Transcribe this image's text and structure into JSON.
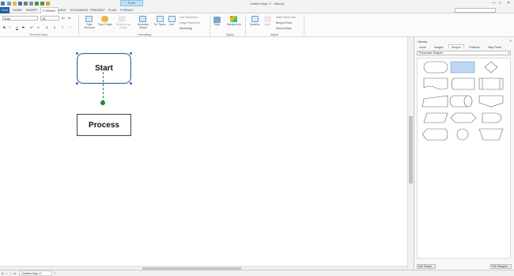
{
  "window": {
    "title": "Untitled Map 1* - iMindQ",
    "context_tab": "Form",
    "minimize": "—",
    "maximize": "□",
    "close": "✕"
  },
  "menu": {
    "file": "FILE",
    "tabs": [
      "HOME",
      "INSERT",
      "FORMAT",
      "VIEW",
      "EXCHANGE",
      "PRESENT",
      "PLAN",
      "FORMAT"
    ]
  },
  "ribbon": {
    "font_name": "Arial",
    "font_size": "14",
    "format_buttons": [
      "B",
      "I",
      "U",
      "S",
      "A",
      "A"
    ],
    "groups": {
      "text_and_color": "Text and Color",
      "formatting": "Formatting",
      "styles": "Styles",
      "adjust": "Adjust"
    },
    "items": {
      "topic_structure": "Topic Structure",
      "topic_shape": "Topic Shape",
      "relationship_shape": "Relationship Shape",
      "boundary_shape": "Boundary Shape",
      "tie_topics": "Tie Topics",
      "line": "Line",
      "icon_placement": "Icon Placement",
      "image_placement": "Image Placement",
      "numbering": "Numbering",
      "style": "Style",
      "background": "Background",
      "spacing": "Spacing",
      "align": "Align",
      "make_same_size": "Make Same Size",
      "bring_to_front": "Bring to Front",
      "send_to_back": "Send to Back"
    }
  },
  "canvas": {
    "start_label": "Start",
    "process_label": "Process"
  },
  "library": {
    "title": "Library",
    "close": "✕",
    "tabs": [
      "Icons",
      "Images",
      "Shapes",
      "Patterns",
      "Map Parts"
    ],
    "active_tab": "Shapes",
    "category": "Flowchart Shapes",
    "add_shape": "Add Shape...",
    "edit_margins": "Edit Margins..."
  },
  "status": {
    "sheet_tab": "Untitled Map 1*"
  },
  "colors": {
    "accent": "#1f5f9f",
    "selection_blue": "#3b6ea5",
    "connector_green": "#1f8a3b",
    "shape_selected_fill": "#bcd8f2"
  }
}
